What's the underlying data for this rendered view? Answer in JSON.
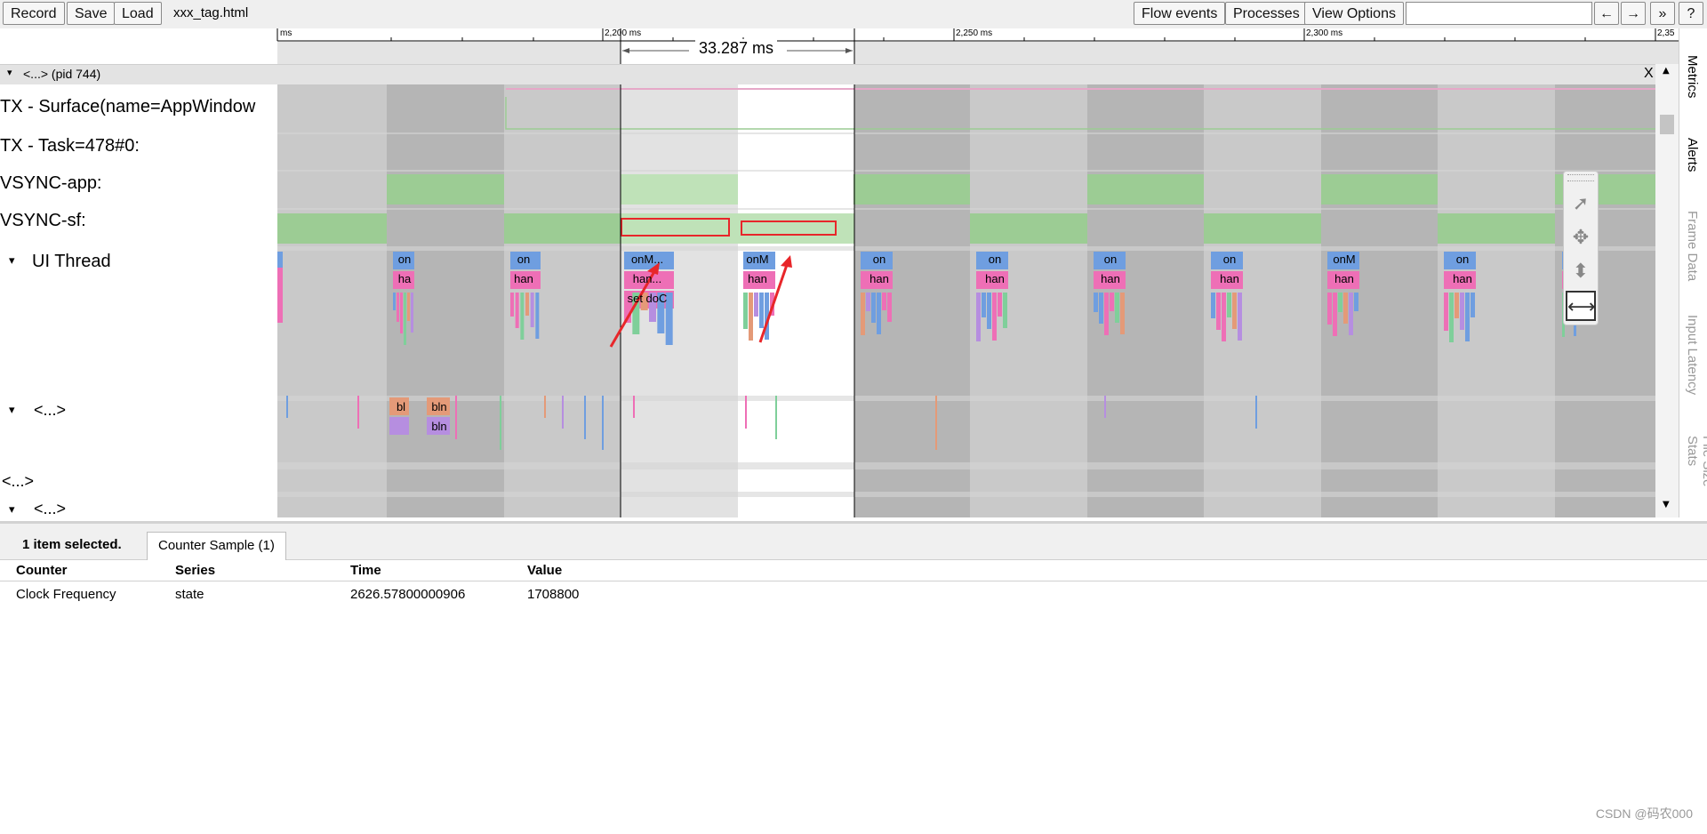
{
  "toolbar": {
    "record_label": "Record",
    "save_label": "Save",
    "load_label": "Load",
    "filename": "xxx_tag.html",
    "flow_events_label": "Flow events",
    "processes_label": "Processes",
    "view_options_label": "View Options",
    "search_placeholder": "",
    "prev_label": "←",
    "next_label": "→",
    "more_label": "»",
    "help_label": "?"
  },
  "ruler": {
    "unit_label": "ms",
    "ticks": [
      "2,200 ms",
      "2,250 ms",
      "2,300 ms",
      "2,35"
    ],
    "selection_duration": "33.287 ms"
  },
  "process": {
    "title": "<...> (pid 744)",
    "close_label": "X"
  },
  "tracks": {
    "tx_surface": "TX - Surface(name=AppWindow",
    "tx_task": "TX - Task=478#0:",
    "vsync_app": "VSYNC-app:",
    "vsync_sf": "VSYNC-sf:",
    "ui_thread": "UI Thread",
    "thread_a": "<...>",
    "thread_b": "<...>",
    "thread_c": "<...>"
  },
  "slices": {
    "on": "on",
    "onM": "onM",
    "onM_ellipsis": "onM...",
    "ha": "ha",
    "han": "han",
    "han_ellipsis": "han...",
    "set_doc": "set doC",
    "bl": "bl",
    "bln": "bln"
  },
  "side_tabs": [
    "Metrics",
    "Alerts",
    "Frame Data",
    "Input Latency",
    "File Size Stats"
  ],
  "bottom": {
    "selection_summary": "1 item selected.",
    "tab_label": "Counter Sample (1)",
    "columns": [
      "Counter",
      "Series",
      "Time",
      "Value"
    ],
    "rows": [
      {
        "counter": "Clock Frequency",
        "series": "state",
        "time": "2626.57800000906",
        "value": "1708800"
      }
    ]
  },
  "nav_tools": [
    "select-icon",
    "pan-icon",
    "zoom-icon",
    "timing-icon"
  ],
  "watermark": "CSDN @码农000",
  "colors": {
    "vsync_green": "#9ccc94",
    "highlight_red": "#e8262a",
    "slice_blue": "#6f9ee0",
    "slice_pink": "#ee6fb6",
    "slice_purple": "#b68ee0"
  }
}
